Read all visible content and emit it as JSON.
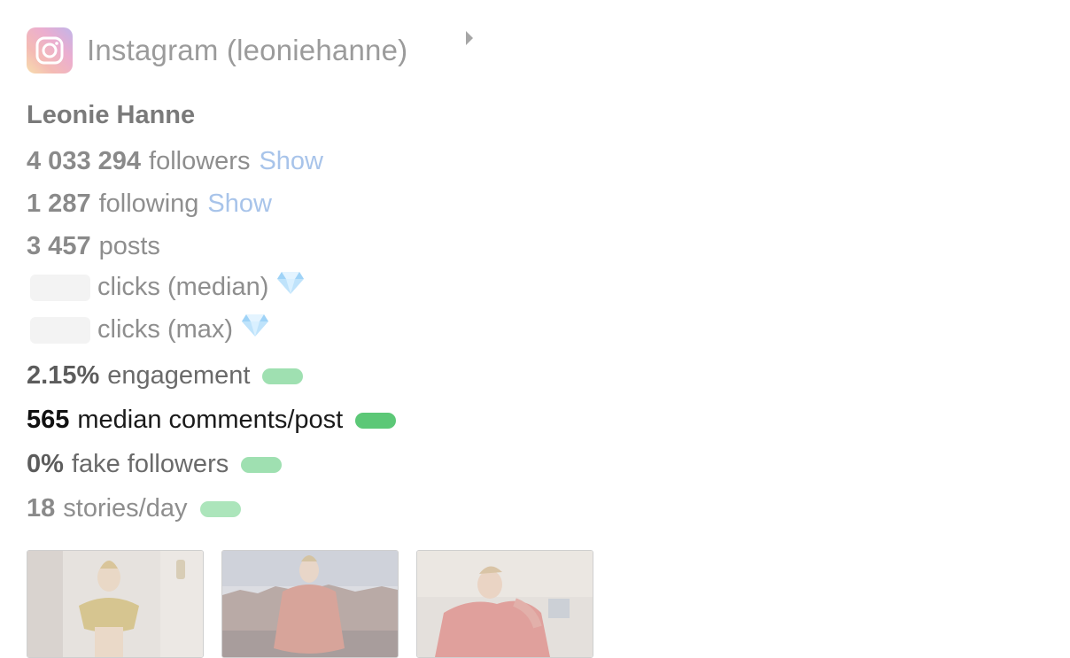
{
  "header": {
    "title": "Instagram (leoniehanne)",
    "icon": "instagram-icon",
    "expand_icon": "caret-right-icon"
  },
  "profile": {
    "name": "Leonie Hanne"
  },
  "stats": {
    "followers": {
      "value": "4 033 294",
      "label": "followers",
      "action": "Show"
    },
    "following": {
      "value": "1 287",
      "label": "following",
      "action": "Show"
    },
    "posts": {
      "value": "3 457",
      "label": "posts"
    },
    "clicks_median": {
      "label": "clicks (median)",
      "badge_icon": "diamond-icon"
    },
    "clicks_max": {
      "label": "clicks (max)",
      "badge_icon": "diamond-icon"
    },
    "engagement": {
      "value": "2.15%",
      "label": "engagement"
    },
    "median_comments": {
      "value": "565",
      "label": "median comments/post"
    },
    "fake_followers": {
      "value": "0%",
      "label": "fake followers"
    },
    "stories": {
      "value": "18",
      "label": "stories/day"
    }
  },
  "colors": {
    "show_link": "#a8c4ea",
    "rating_green_strong": "#5cc877",
    "rating_green_light": "#9fe0b1"
  },
  "thumbnails": [
    {
      "icon": "post-thumbnail-1"
    },
    {
      "icon": "post-thumbnail-2"
    },
    {
      "icon": "post-thumbnail-3"
    }
  ]
}
